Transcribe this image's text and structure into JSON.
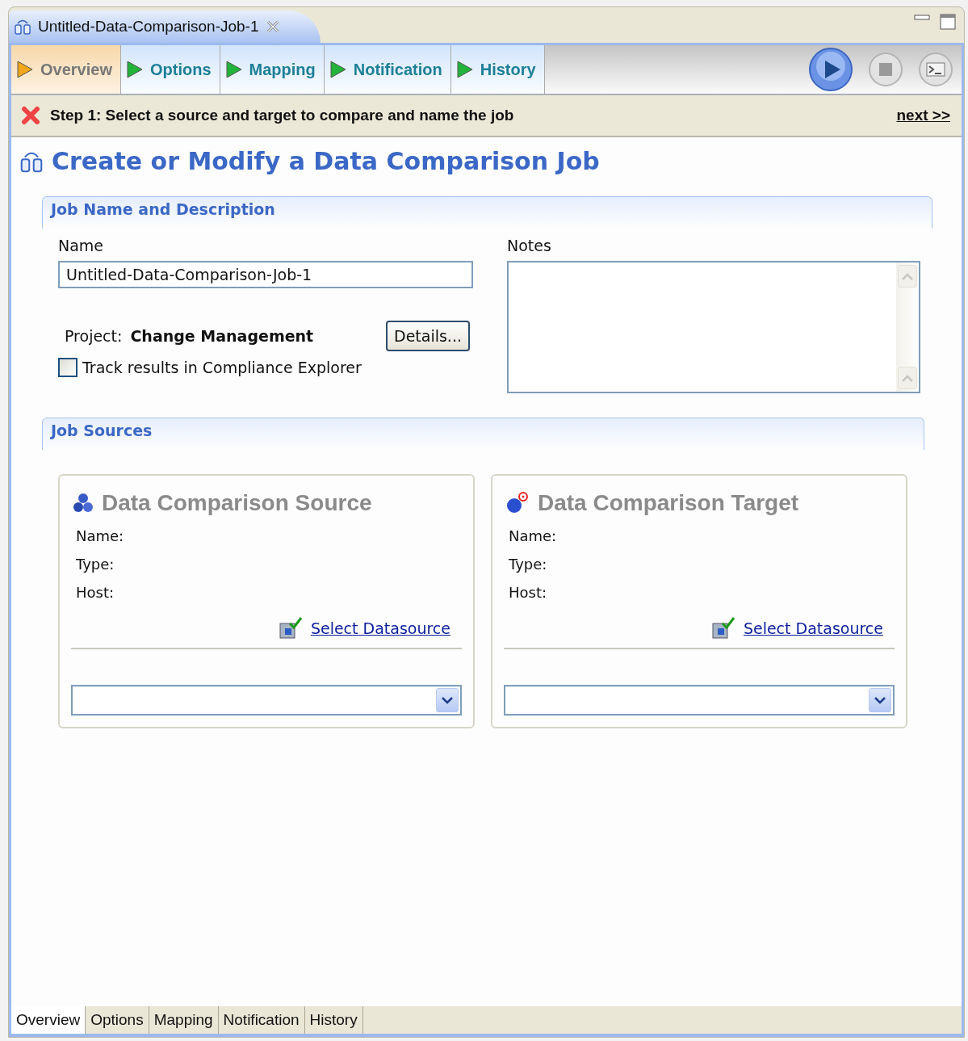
{
  "editor_tab": {
    "title": "Untitled-Data-Comparison-Job-1"
  },
  "wizard_tabs": [
    {
      "label": "Overview",
      "selected": true
    },
    {
      "label": "Options",
      "selected": false
    },
    {
      "label": "Mapping",
      "selected": false
    },
    {
      "label": "Notification",
      "selected": false
    },
    {
      "label": "History",
      "selected": false
    }
  ],
  "step_bar": {
    "message": "Step 1: Select a source and target to compare and name the job",
    "next_link": "next >>"
  },
  "heading": "Create or Modify a Data Comparison Job",
  "job_section": {
    "title": "Job Name and Description",
    "name_label": "Name",
    "name_value": "Untitled-Data-Comparison-Job-1",
    "notes_label": "Notes",
    "project_label": "Project:",
    "project_value": "Change Management",
    "details_button": "Details...",
    "track_checkbox": {
      "label": "Track results in Compliance Explorer",
      "checked": false
    }
  },
  "sources_section": {
    "title": "Job Sources",
    "panels": [
      {
        "kind": "source",
        "title": "Data Comparison Source",
        "fields": [
          "Name:",
          "Type:",
          "Host:"
        ],
        "link": "Select Datasource"
      },
      {
        "kind": "target",
        "title": "Data Comparison Target",
        "fields": [
          "Name:",
          "Type:",
          "Host:"
        ],
        "link": "Select Datasource"
      }
    ]
  },
  "bottom_tabs": [
    {
      "label": "Overview",
      "selected": true
    },
    {
      "label": "Options",
      "selected": false
    },
    {
      "label": "Mapping",
      "selected": false
    },
    {
      "label": "Notification",
      "selected": false
    },
    {
      "label": "History",
      "selected": false
    }
  ]
}
